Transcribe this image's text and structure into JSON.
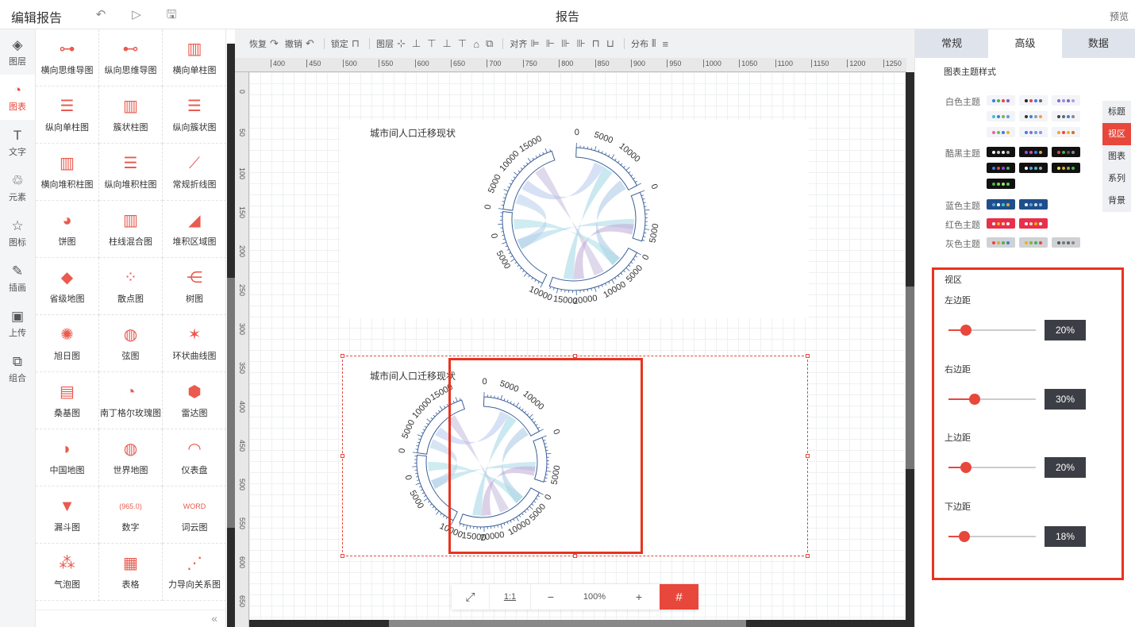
{
  "topbar": {
    "app_title": "编辑报告",
    "doc_title": "报告",
    "preview": "预览"
  },
  "leftnav": [
    {
      "label": "图层",
      "icon": "layers-icon",
      "glyph": "◈"
    },
    {
      "label": "图表",
      "icon": "chart-icon",
      "glyph": "◔"
    },
    {
      "label": "文字",
      "icon": "text-icon",
      "glyph": "T"
    },
    {
      "label": "元素",
      "icon": "elements-icon",
      "glyph": "♲"
    },
    {
      "label": "图标",
      "icon": "star-icon",
      "glyph": "☆"
    },
    {
      "label": "插画",
      "icon": "palette-icon",
      "glyph": "✎"
    },
    {
      "label": "上传",
      "icon": "upload-image-icon",
      "glyph": "▣"
    },
    {
      "label": "组合",
      "icon": "group-icon",
      "glyph": "⧉"
    }
  ],
  "palette": [
    {
      "label": "横向思维导图",
      "glyph": "⊶"
    },
    {
      "label": "纵向思维导图",
      "glyph": "⊷"
    },
    {
      "label": "横向单柱图",
      "glyph": "▥"
    },
    {
      "label": "纵向单柱图",
      "glyph": "☰"
    },
    {
      "label": "簇状柱图",
      "glyph": "▥"
    },
    {
      "label": "纵向簇状图",
      "glyph": "☰"
    },
    {
      "label": "横向堆积柱图",
      "glyph": "▥"
    },
    {
      "label": "纵向堆积柱图",
      "glyph": "☰"
    },
    {
      "label": "常规折线图",
      "glyph": "⟋"
    },
    {
      "label": "饼图",
      "glyph": "◕"
    },
    {
      "label": "柱线混合图",
      "glyph": "▥"
    },
    {
      "label": "堆积区域图",
      "glyph": "◢"
    },
    {
      "label": "省级地图",
      "glyph": "◆"
    },
    {
      "label": "散点图",
      "glyph": "⁘"
    },
    {
      "label": "树图",
      "glyph": "⋲"
    },
    {
      "label": "旭日图",
      "glyph": "✺"
    },
    {
      "label": "弦图",
      "glyph": "◍"
    },
    {
      "label": "环状曲线图",
      "glyph": "✶"
    },
    {
      "label": "桑基图",
      "glyph": "▤"
    },
    {
      "label": "南丁格尔玫瑰图",
      "glyph": "◔"
    },
    {
      "label": "雷达图",
      "glyph": "⬢"
    },
    {
      "label": "中国地图",
      "glyph": "◗"
    },
    {
      "label": "世界地图",
      "glyph": "◍"
    },
    {
      "label": "仪表盘",
      "glyph": "◠"
    },
    {
      "label": "漏斗图",
      "glyph": "▼"
    },
    {
      "label": "数字",
      "glyph": "(965.0)"
    },
    {
      "label": "词云图",
      "glyph": "WORD"
    },
    {
      "label": "气泡图",
      "glyph": "⁂"
    },
    {
      "label": "表格",
      "glyph": "▦"
    },
    {
      "label": "力导向关系图",
      "glyph": "⋰"
    }
  ],
  "toolbar": {
    "redo": "恢复",
    "undo": "撤销",
    "lock": "锁定",
    "layer": "图层",
    "align": "对齐",
    "distribute": "分布"
  },
  "ruler_labels": [
    "400",
    "450",
    "500",
    "550",
    "600",
    "650",
    "700",
    "750",
    "800",
    "850",
    "900",
    "950",
    "1000",
    "1050",
    "1100",
    "1150",
    "1200",
    "1250"
  ],
  "ruler_v_labels": [
    "0",
    "50",
    "100",
    "150",
    "200",
    "250",
    "300",
    "350",
    "400",
    "450",
    "500",
    "550",
    "600",
    "650"
  ],
  "charts": [
    {
      "title": "城市间人口迁移现状"
    },
    {
      "title": "城市间人口迁移现状"
    }
  ],
  "chord_labels": [
    "15000",
    "10000",
    "5000",
    "0",
    "0",
    "5000",
    "10000",
    "0",
    "5000",
    "0",
    "5000",
    "10000",
    "20000",
    "15000",
    "10000",
    "5000",
    "0"
  ],
  "zoom": {
    "fit": "⤢",
    "ratio": "1:1",
    "minus": "−",
    "value": "100%",
    "plus": "+",
    "grid": "#"
  },
  "rightpanel": {
    "tabs": [
      "常规",
      "高级",
      "数据"
    ],
    "active_tab": 1,
    "theme_section": "图表主题样式",
    "themes": [
      {
        "label": "白色主题"
      },
      {
        "label": "酷黑主题"
      },
      {
        "label": "蓝色主题"
      },
      {
        "label": "红色主题"
      },
      {
        "label": "灰色主题"
      }
    ],
    "side_tabs": [
      "标题",
      "视区",
      "图表",
      "系列",
      "背景"
    ],
    "active_side_tab": 1,
    "viewport": {
      "title": "视区",
      "controls": [
        {
          "label": "左边距",
          "value": "20%",
          "level": 0.2
        },
        {
          "label": "右边距",
          "value": "30%",
          "level": 0.3
        },
        {
          "label": "上边距",
          "value": "20%",
          "level": 0.2
        },
        {
          "label": "下边距",
          "value": "18%",
          "level": 0.18
        }
      ]
    }
  },
  "colors": {
    "accent": "#e8473c",
    "highlight": "#e8331f",
    "dark": "#2b2b2b"
  }
}
